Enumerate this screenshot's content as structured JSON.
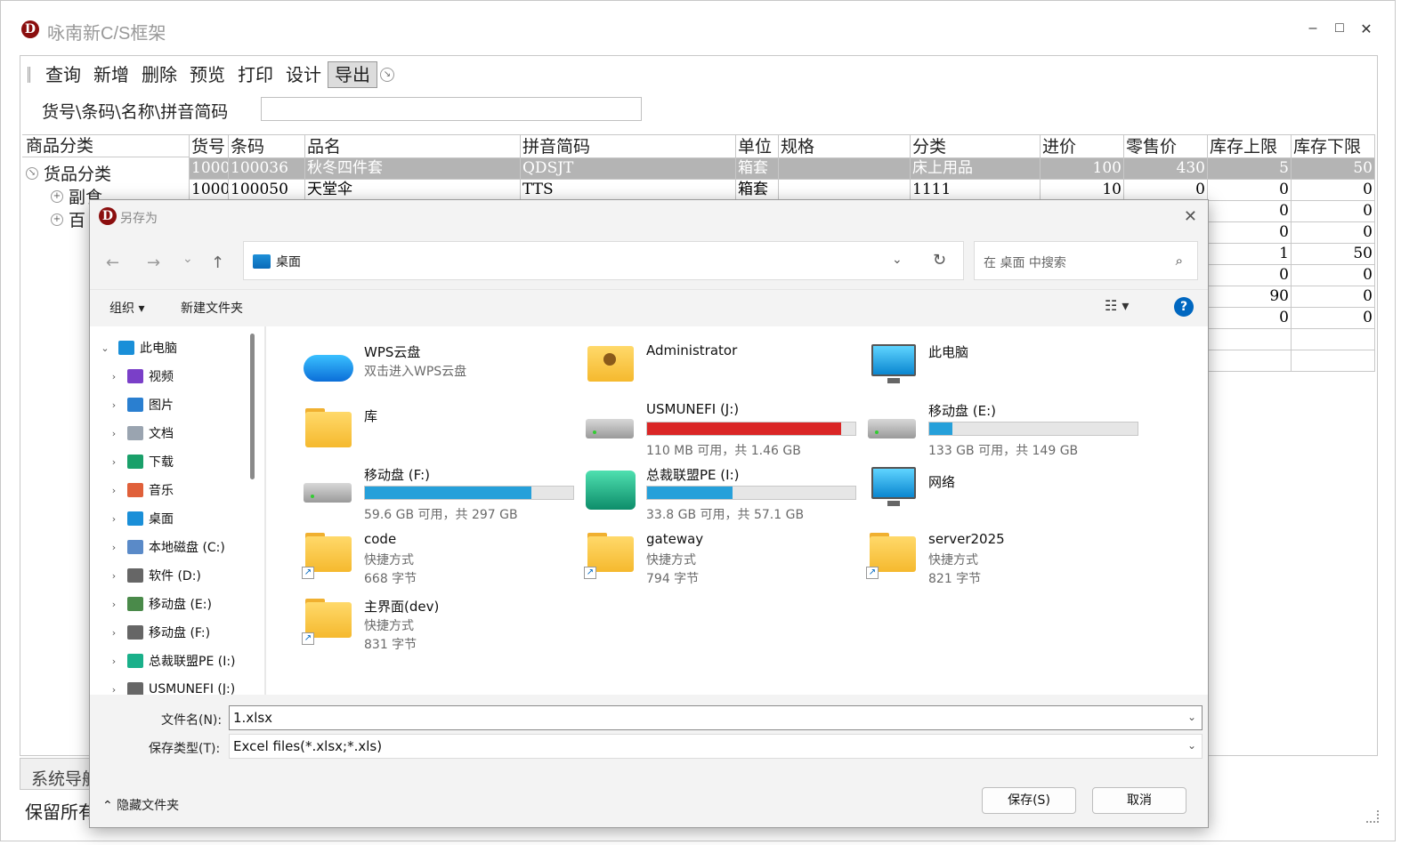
{
  "app": {
    "title": "咏南新C/S框架",
    "logo_letter": "D",
    "win_min": "–",
    "win_max": "□",
    "win_close": "✕"
  },
  "toolbar": {
    "items": [
      "查询",
      "新增",
      "删除",
      "预览",
      "打印",
      "设计",
      "导出"
    ],
    "active": "导出"
  },
  "search": {
    "label": "货号\\条码\\名称\\拼音简码",
    "value": ""
  },
  "category": {
    "header": "商品分类",
    "root": "货品分类",
    "children": [
      "副食",
      "百"
    ]
  },
  "grid": {
    "columns": [
      "货号",
      "条码",
      "品名",
      "拼音简码",
      "单位",
      "规格",
      "分类",
      "进价",
      "零售价",
      "库存上限",
      "库存下限"
    ],
    "rows": [
      [
        "1000",
        "100036",
        "秋冬四件套",
        "QDSJT",
        "箱套",
        "",
        "床上用品",
        "100",
        "430",
        "5",
        "50"
      ],
      [
        "1000",
        "100050",
        "天堂伞",
        "TTS",
        "箱套",
        "",
        "1111",
        "10",
        "0",
        "0",
        "0"
      ],
      [
        "",
        "",
        "",
        "",
        "",
        "",
        "",
        "",
        "",
        "0",
        "0"
      ],
      [
        "",
        "",
        "",
        "",
        "",
        "",
        "",
        "",
        "",
        "0",
        "0"
      ],
      [
        "",
        "",
        "",
        "",
        "",
        "",
        "",
        "",
        "",
        "1",
        "50"
      ],
      [
        "",
        "",
        "",
        "",
        "",
        "",
        "",
        "",
        "",
        "0",
        "0"
      ],
      [
        "",
        "",
        "",
        "",
        "",
        "",
        "",
        "",
        "",
        "90",
        "0"
      ],
      [
        "",
        "",
        "",
        "",
        "",
        "",
        "",
        "",
        "",
        "0",
        "0"
      ],
      [
        "",
        "",
        "",
        "",
        "",
        "",
        "",
        "",
        "",
        "",
        ""
      ],
      [
        "",
        "",
        "",
        "",
        "",
        "",
        "",
        "",
        "",
        "",
        ""
      ]
    ]
  },
  "nav_tab": "系统导航",
  "footer": "保留所有",
  "dialog": {
    "title": "另存为",
    "logo_letter": "D",
    "close": "✕",
    "back": "←",
    "forward": "→",
    "recent": "⌄",
    "up": "↑",
    "address": "桌面",
    "address_dd": "⌄",
    "refresh": "↻",
    "search_placeholder": "在 桌面 中搜索",
    "search_icon": "⌕",
    "organize": "组织 ▾",
    "new_folder": "新建文件夹",
    "view_options": "☷ ▾",
    "help": "?",
    "nav": [
      {
        "label": "此电脑",
        "chev": "⌄",
        "icon": "pc-icon",
        "color": "#1a8fd8"
      },
      {
        "label": "视频",
        "chev": "›",
        "icon": "video-icon",
        "color": "#7a3fc8"
      },
      {
        "label": "图片",
        "chev": "›",
        "icon": "pictures-icon",
        "color": "#2a7fd0"
      },
      {
        "label": "文档",
        "chev": "›",
        "icon": "documents-icon",
        "color": "#9aa4b0"
      },
      {
        "label": "下载",
        "chev": "›",
        "icon": "download-icon",
        "color": "#1aa06a"
      },
      {
        "label": "音乐",
        "chev": "›",
        "icon": "music-icon",
        "color": "#e0603a"
      },
      {
        "label": "桌面",
        "chev": "›",
        "icon": "desktop-icon",
        "color": "#1a8fd8"
      },
      {
        "label": "本地磁盘 (C:)",
        "chev": "›",
        "icon": "drive-c-icon",
        "color": "#5a8ac8"
      },
      {
        "label": "软件 (D:)",
        "chev": "›",
        "icon": "drive-d-icon",
        "color": "#666"
      },
      {
        "label": "移动盘 (E:)",
        "chev": "›",
        "icon": "drive-e-icon",
        "color": "#4a8a4a"
      },
      {
        "label": "移动盘 (F:)",
        "chev": "›",
        "icon": "drive-f-icon",
        "color": "#666"
      },
      {
        "label": "总裁联盟PE (I:)",
        "chev": "›",
        "icon": "drive-i-icon",
        "color": "#1ab08a"
      },
      {
        "label": "USMUNEFI (J:)",
        "chev": "›",
        "icon": "drive-j-icon",
        "color": "#666"
      }
    ],
    "tiles": {
      "wps": {
        "name": "WPS云盘",
        "sub": "双击进入WPS云盘"
      },
      "admin": {
        "name": "Administrator"
      },
      "thispc": {
        "name": "此电脑"
      },
      "library": {
        "name": "库"
      },
      "usmunefi": {
        "name": "USMUNEFI (J:)",
        "sub": "110 MB 可用，共 1.46 GB",
        "used_fraction": 0.93
      },
      "drive_e": {
        "name": "移动盘 (E:)",
        "sub": "133 GB 可用，共 149 GB",
        "used_fraction": 0.11
      },
      "drive_f": {
        "name": "移动盘 (F:)",
        "sub": "59.6 GB 可用，共 297 GB",
        "used_fraction": 0.8
      },
      "drive_i": {
        "name": "总裁联盟PE (I:)",
        "sub": "33.8 GB 可用，共 57.1 GB",
        "used_fraction": 0.41
      },
      "network": {
        "name": "网络"
      },
      "code": {
        "name": "code",
        "sub": "快捷方式",
        "sub2": "668 字节"
      },
      "gateway": {
        "name": "gateway",
        "sub": "快捷方式",
        "sub2": "794 字节"
      },
      "server2025": {
        "name": "server2025",
        "sub": "快捷方式",
        "sub2": "821 字节"
      },
      "main_dev": {
        "name": "主界面(dev)",
        "sub": "快捷方式",
        "sub2": "831 字节"
      }
    },
    "filename_label": "文件名(N):",
    "filename_value": "1.xlsx",
    "filetype_label": "保存类型(T):",
    "filetype_value": "Excel files(*.xlsx;*.xls)",
    "dd_chev": "⌄",
    "hide_folders": "⌃ 隐藏文件夹",
    "save": "保存(S)",
    "cancel": "取消",
    "shortcut_arrow": "↗"
  }
}
